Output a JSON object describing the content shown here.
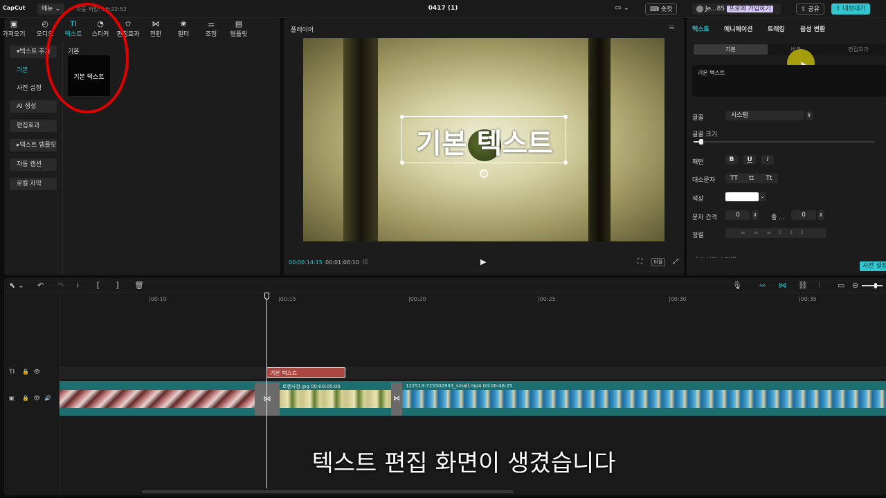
{
  "app": {
    "logo": "CapCut",
    "menu_label": "메뉴",
    "autosave": "자동 저장: 16:22:52",
    "project_title": "0417 (1)",
    "shortcut_label": "숏컷",
    "user_name": "Je...85",
    "pro_label": "프로에 가입하기",
    "share_label": "공유",
    "export_label": "내보내기"
  },
  "tools": [
    {
      "label": "가져오기",
      "icon": "import-icon",
      "glyph": "▣"
    },
    {
      "label": "오디오",
      "icon": "audio-icon",
      "glyph": "◴"
    },
    {
      "label": "텍스트",
      "icon": "text-icon",
      "glyph": "TI"
    },
    {
      "label": "스티커",
      "icon": "sticker-icon",
      "glyph": "◔"
    },
    {
      "label": "편집효과",
      "icon": "effects-icon",
      "glyph": "✩"
    },
    {
      "label": "전환",
      "icon": "transition-icon",
      "glyph": "⋈"
    },
    {
      "label": "필터",
      "icon": "filter-icon",
      "glyph": "❀"
    },
    {
      "label": "조정",
      "icon": "adjust-icon",
      "glyph": "⚌"
    },
    {
      "label": "템플릿",
      "icon": "template-icon",
      "glyph": "▤"
    }
  ],
  "sidebar": {
    "items": [
      {
        "label": "▾텍스트 추가"
      },
      {
        "label": "기본"
      },
      {
        "label": "사전 설정"
      },
      {
        "label": "AI 생성"
      },
      {
        "label": "편집효과"
      },
      {
        "label": "▸텍스트 템플릿"
      },
      {
        "label": "자동 캡션"
      },
      {
        "label": "로컬 자막"
      }
    ]
  },
  "library": {
    "section_title": "기본",
    "card_label": "기본 텍스트"
  },
  "player": {
    "title": "플레이어",
    "overlay_text": "기본 텍스트",
    "current_time": "00:00:14:15",
    "total_time": "00:01:06:10",
    "ratio_label": "비율"
  },
  "right_panel": {
    "tabs": [
      "텍스트",
      "애니메이션",
      "트래킹",
      "음성 변환"
    ],
    "subtabs": [
      "기본",
      "버블",
      "편집효과"
    ],
    "text_value": "기본 텍스트",
    "font_label": "글꼴",
    "font_value": "시스템",
    "font_size_label": "글꼴 크기",
    "pattern_label": "패턴",
    "pattern_buttons": [
      "B",
      "U",
      "I"
    ],
    "case_label": "대소문자",
    "case_buttons": [
      "TT",
      "tt",
      "Tt"
    ],
    "color_label": "색상",
    "color_value": "#ffffff",
    "spacing_label": "문자 간격",
    "spacing_value": "0",
    "line_label": "줄 ...",
    "line_value": "0",
    "align_label": "정렬",
    "cut_label": "서식 설정 스타일",
    "preset_button": "사전 설정"
  },
  "timeline": {
    "ticks": [
      "|00:10",
      "|00:15",
      "|00:20",
      "|00:25",
      "|00:30",
      "|00:35"
    ],
    "text_clip_label": "기본 텍스트",
    "clip2_label": "로렌사장.jpg  00:00:05:00",
    "clip3_label": "122513-725502933_small.mp4  00:00:46:25"
  },
  "subtitle": "텍스트 편집 화면이 생겼습니다",
  "colors": {
    "accent": "#33c6cf",
    "annotation": "#e00000",
    "text_clip": "#a8473f",
    "video_track": "#1d6f6f"
  }
}
